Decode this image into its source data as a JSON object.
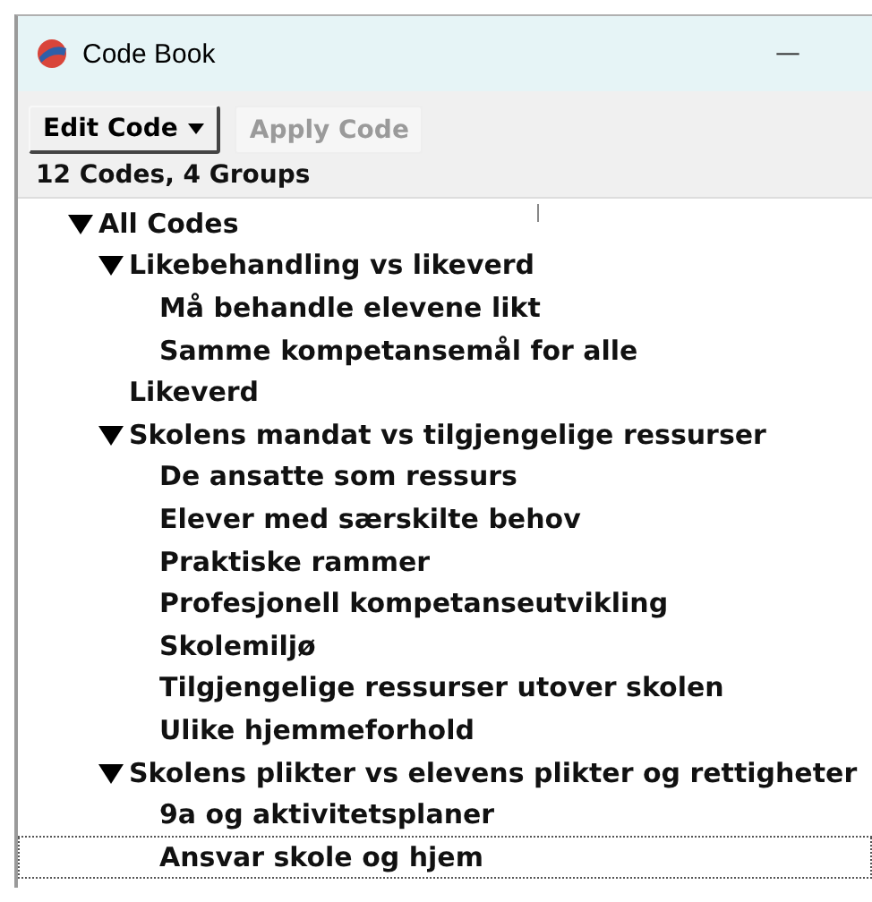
{
  "window": {
    "title": "Code Book",
    "minimize": "—"
  },
  "toolbar": {
    "buttons": [
      {
        "label": "Edit Code",
        "kind": "menu",
        "disabled": false
      },
      {
        "label": "Apply Code",
        "kind": "plain",
        "disabled": true
      }
    ]
  },
  "summary": "12 Codes, 4 Groups",
  "tree": [
    {
      "label": "All Codes",
      "expanded": true,
      "focused": false,
      "children": [
        {
          "label": "Likebehandling vs likeverd",
          "expanded": true,
          "focused": false,
          "children": [
            {
              "label": "Må behandle elevene likt",
              "focused": false
            },
            {
              "label": "Samme kompetansemål for alle",
              "focused": false
            }
          ]
        },
        {
          "label": "Likeverd",
          "focused": false
        },
        {
          "label": "Skolens mandat vs tilgjengelige ressurser",
          "expanded": true,
          "focused": false,
          "children": [
            {
              "label": "De ansatte som ressurs",
              "focused": false
            },
            {
              "label": "Elever med særskilte behov",
              "focused": false
            },
            {
              "label": "Praktiske rammer",
              "focused": false
            },
            {
              "label": "Profesjonell kompetanseutvikling",
              "focused": false
            },
            {
              "label": "Skolemiljø",
              "focused": false
            },
            {
              "label": "Tilgjengelige ressurser utover skolen",
              "focused": false
            },
            {
              "label": "Ulike hjemmeforhold",
              "focused": false
            }
          ]
        },
        {
          "label": "Skolens plikter vs elevens plikter og rettigheter",
          "expanded": true,
          "focused": false,
          "children": [
            {
              "label": "9a og aktivitetsplaner",
              "focused": false
            },
            {
              "label": "Ansvar skole og hjem",
              "focused": true
            }
          ]
        }
      ]
    }
  ]
}
